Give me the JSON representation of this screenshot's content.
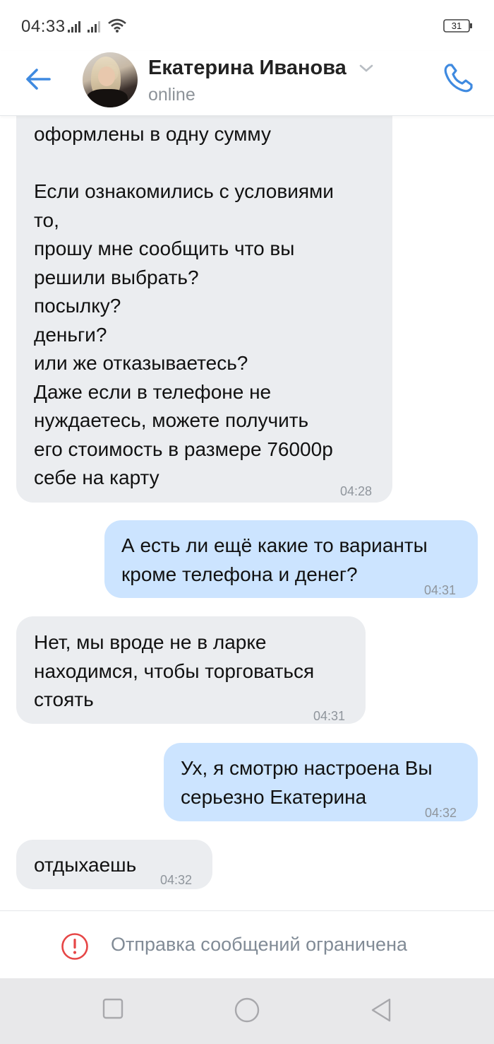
{
  "status_bar": {
    "time": "04:33",
    "battery": "31"
  },
  "header": {
    "contact_name": "Екатерина Иванова",
    "status": "online"
  },
  "messages": [
    {
      "direction": "in",
      "text": "оформлены в одну сумму\n\nЕсли ознакомились с условиями\nто,\nпрошу мне сообщить что вы\nрешили выбрать?\nпосылку?\nденьги?\nили же отказываетесь?\nДаже если в телефоне не\nнуждаетесь, можете получить\nего стоимость в размере 76000р\nсебе на карту",
      "time": "04:28"
    },
    {
      "direction": "out",
      "text": "А есть ли ещё какие то варианты\nкроме телефона и денег?",
      "time": "04:31"
    },
    {
      "direction": "in",
      "text": "Нет, мы вроде не в ларке\nнаходимся, чтобы торговаться\nстоять",
      "time": "04:31"
    },
    {
      "direction": "out",
      "text": "Ух, я смотрю настроена Вы\nсерьезно Екатерина",
      "time": "04:32"
    },
    {
      "direction": "in",
      "text": "отдыхаешь",
      "time": "04:32"
    }
  ],
  "restricted_notice": "Отправка сообщений ограничена",
  "colors": {
    "accent": "#3f8ae0",
    "incoming_bubble": "#ebedf0",
    "outgoing_bubble": "#cce4ff",
    "warning": "#e64646"
  }
}
